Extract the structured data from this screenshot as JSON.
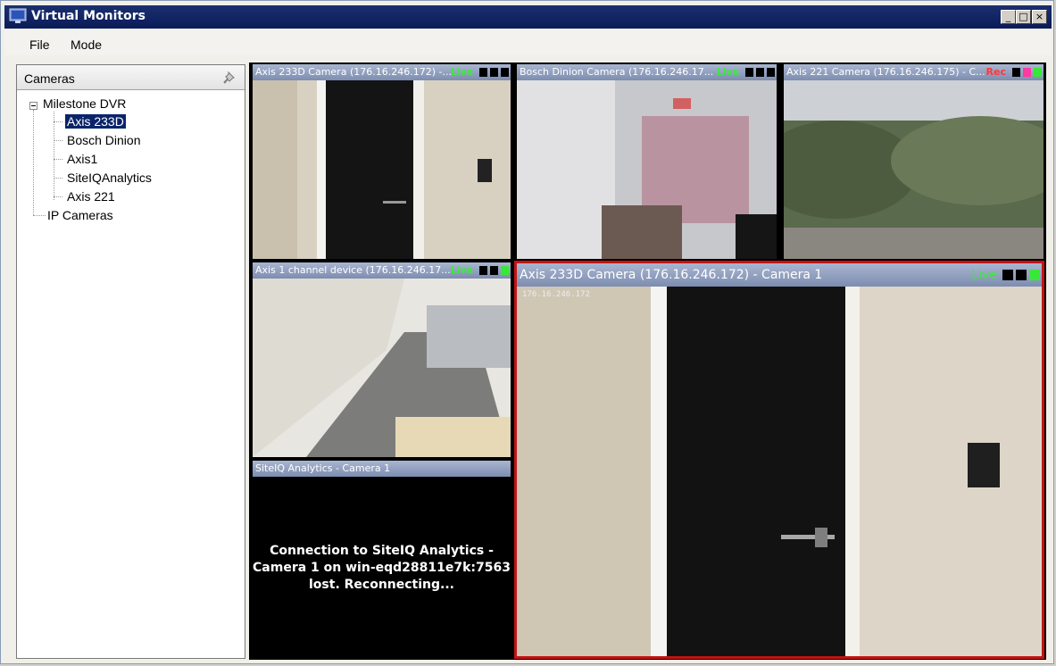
{
  "window": {
    "title": "Virtual Monitors"
  },
  "window_buttons": {
    "minimize": "_",
    "maximize": "□",
    "close": "×"
  },
  "menu": {
    "file": "File",
    "mode": "Mode"
  },
  "sidebar": {
    "title": "Cameras",
    "tree": {
      "root": "Milestone DVR",
      "cameras": [
        "Axis 233D",
        "Bosch Dinion",
        "Axis1",
        "SiteIQAnalytics",
        "Axis 221"
      ],
      "selected_index": 0,
      "ip_cameras": "IP Cameras"
    }
  },
  "panels": {
    "p1": {
      "title": "Axis 233D Camera (176.16.246.172) -...",
      "status": "Live"
    },
    "p2": {
      "title": "Bosch Dinion Camera (176.16.246.17...",
      "status": "Live"
    },
    "p3": {
      "title": "Axis 221 Camera (176.16.246.175) - C...",
      "status": "Rec"
    },
    "p4": {
      "title": "Axis 1 channel device (176.16.246.17...",
      "status": "Live"
    },
    "p5": {
      "title": "SiteIQ Analytics - Camera 1",
      "message": "Connection to SiteIQ Analytics - Camera 1 on win-eqd28811e7k:7563 lost. Reconnecting..."
    },
    "big": {
      "title": "Axis 233D Camera (176.16.246.172) - Camera 1",
      "status": "Live",
      "overlay": "176.16.246.172"
    }
  },
  "colors": {
    "live": "#3ee83e",
    "rec": "#ff3838",
    "selected_border": "#c31414",
    "titlebar": "#0a1b57"
  }
}
